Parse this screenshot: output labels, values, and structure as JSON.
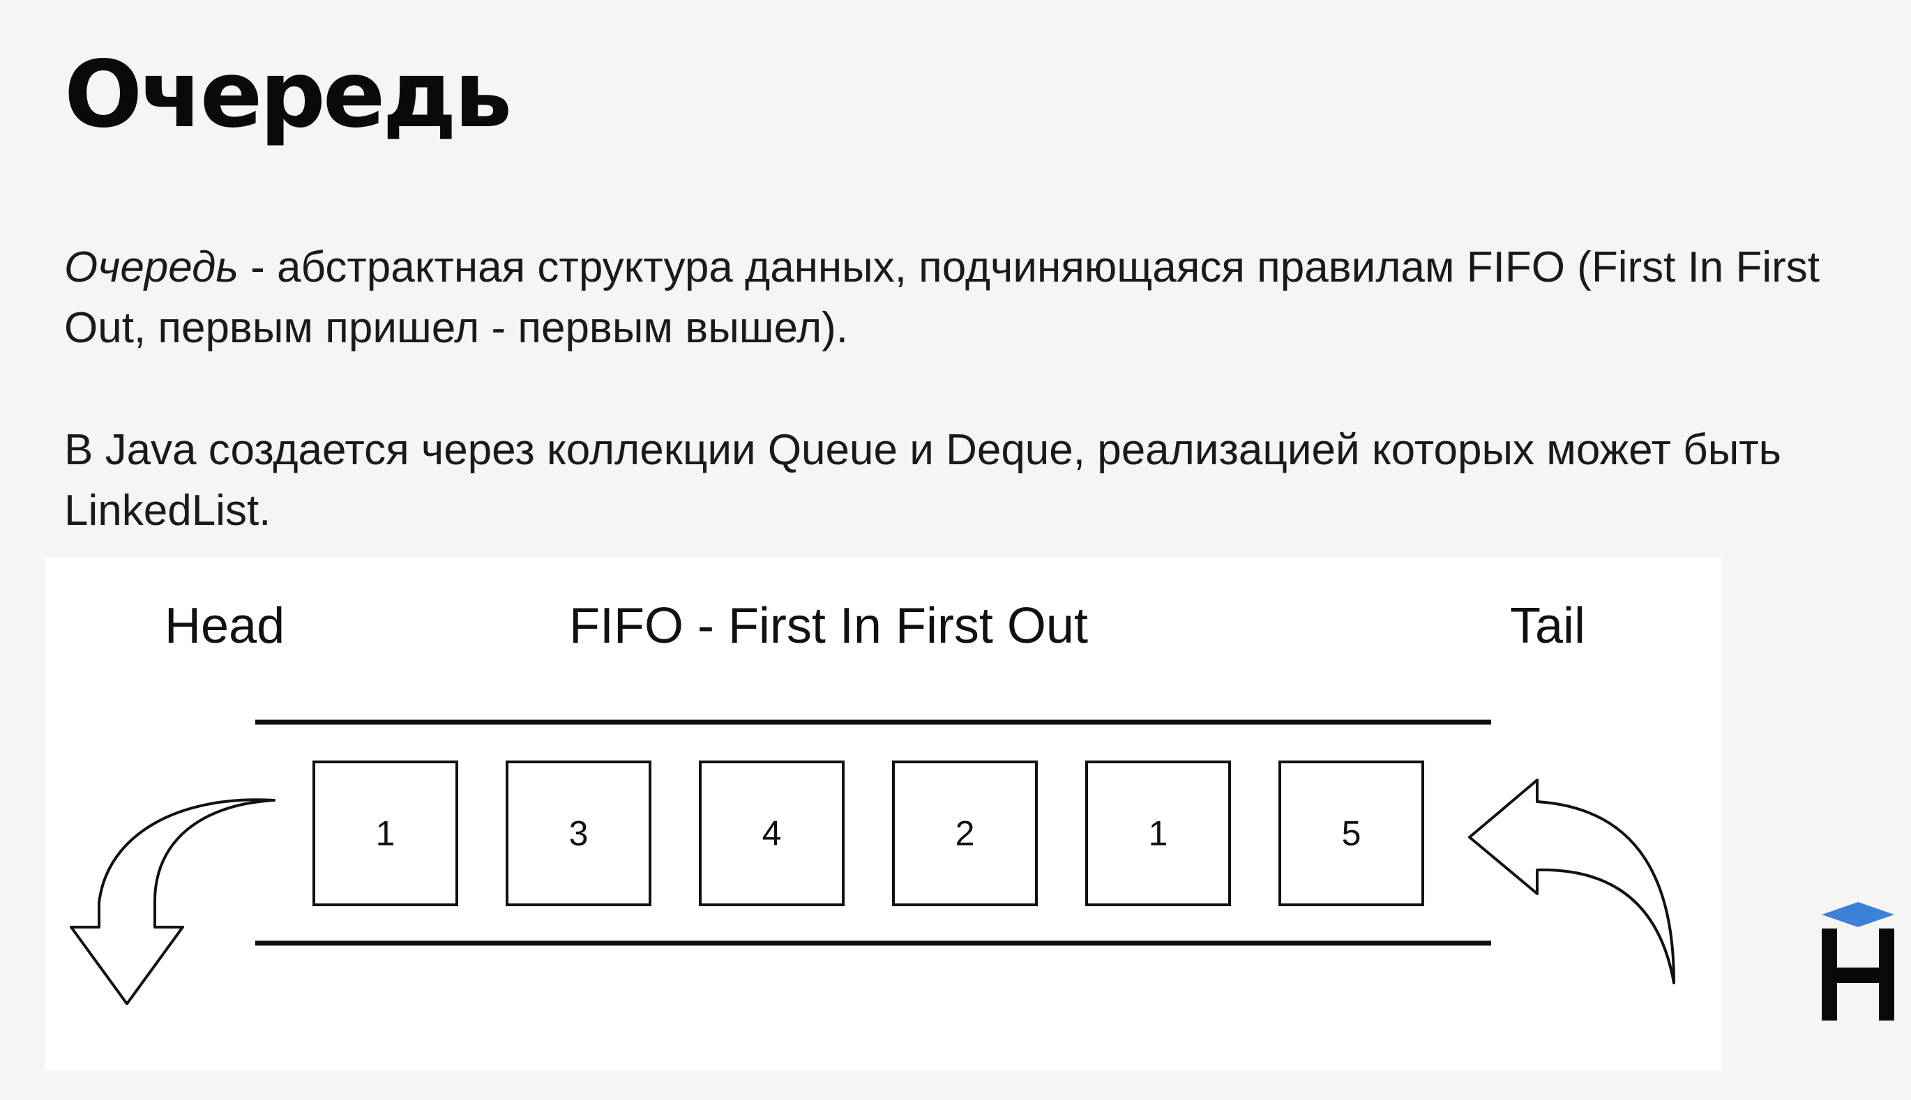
{
  "slide": {
    "title": "Очередь",
    "paragraphs": [
      {
        "term": "Очередь",
        "text": " - абстрактная структура данных, подчиняющаяся правилам FIFO (First In First Out, первым пришел - первым вышел)."
      },
      {
        "text": "В Java создается через коллекции Queue и Deque, реализацией которых может быть LinkedList."
      }
    ]
  },
  "diagram": {
    "head_label": "Head",
    "title": "FIFO - First In First Out",
    "tail_label": "Tail",
    "items": [
      "1",
      "3",
      "4",
      "2",
      "1",
      "5"
    ],
    "icons": {
      "dequeue": "curved-arrow-down-left-icon",
      "enqueue": "curved-arrow-left-icon"
    }
  },
  "logo": {
    "icon": "h-logo-icon",
    "accent_color": "#3b82d6",
    "color": "#0a0a0a"
  }
}
